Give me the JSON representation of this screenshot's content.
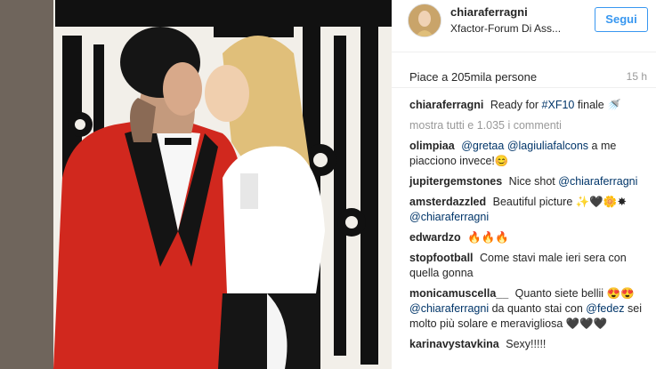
{
  "post": {
    "username": "chiaraferragni",
    "location": "Xfactor-Forum Di Ass...",
    "follow_label": "Segui",
    "likes": "Piace a 205mila persone",
    "time": "15 h"
  },
  "caption": {
    "user": "chiaraferragni",
    "text_before": "Ready for",
    "hashtag": "#XF10",
    "text_after": "finale 🚿"
  },
  "more_comments": "mostra tutti e 1.035 i commenti",
  "comments": [
    {
      "user": "olimpiaa",
      "mention1": "@gretaa",
      "mention2": "@lagiuliafalcons",
      "text": "a me piacciono invece!😊"
    },
    {
      "user": "jupitergemstones",
      "text": "Nice shot",
      "mention": "@chiaraferragni"
    },
    {
      "user": "amsterdazzled",
      "text": "Beautiful picture ✨🖤🌼✸",
      "mention": "@chiaraferragni"
    },
    {
      "user": "edwardzo",
      "text": "🔥🔥🔥"
    },
    {
      "user": "stopfootball",
      "text": "Come stavi male ieri sera con quella gonna"
    },
    {
      "user": "monicamuscella__",
      "text1": "Quanto siete bellii 😍😍",
      "mention1": "@chiaraferragni",
      "text2": "da quanto stai con",
      "mention2": "@fedez",
      "text3": "sei molto più solare e meravigliosa 🖤🖤🖤"
    },
    {
      "user": "karinavystavkina",
      "text": "Sexy!!!!!"
    }
  ]
}
